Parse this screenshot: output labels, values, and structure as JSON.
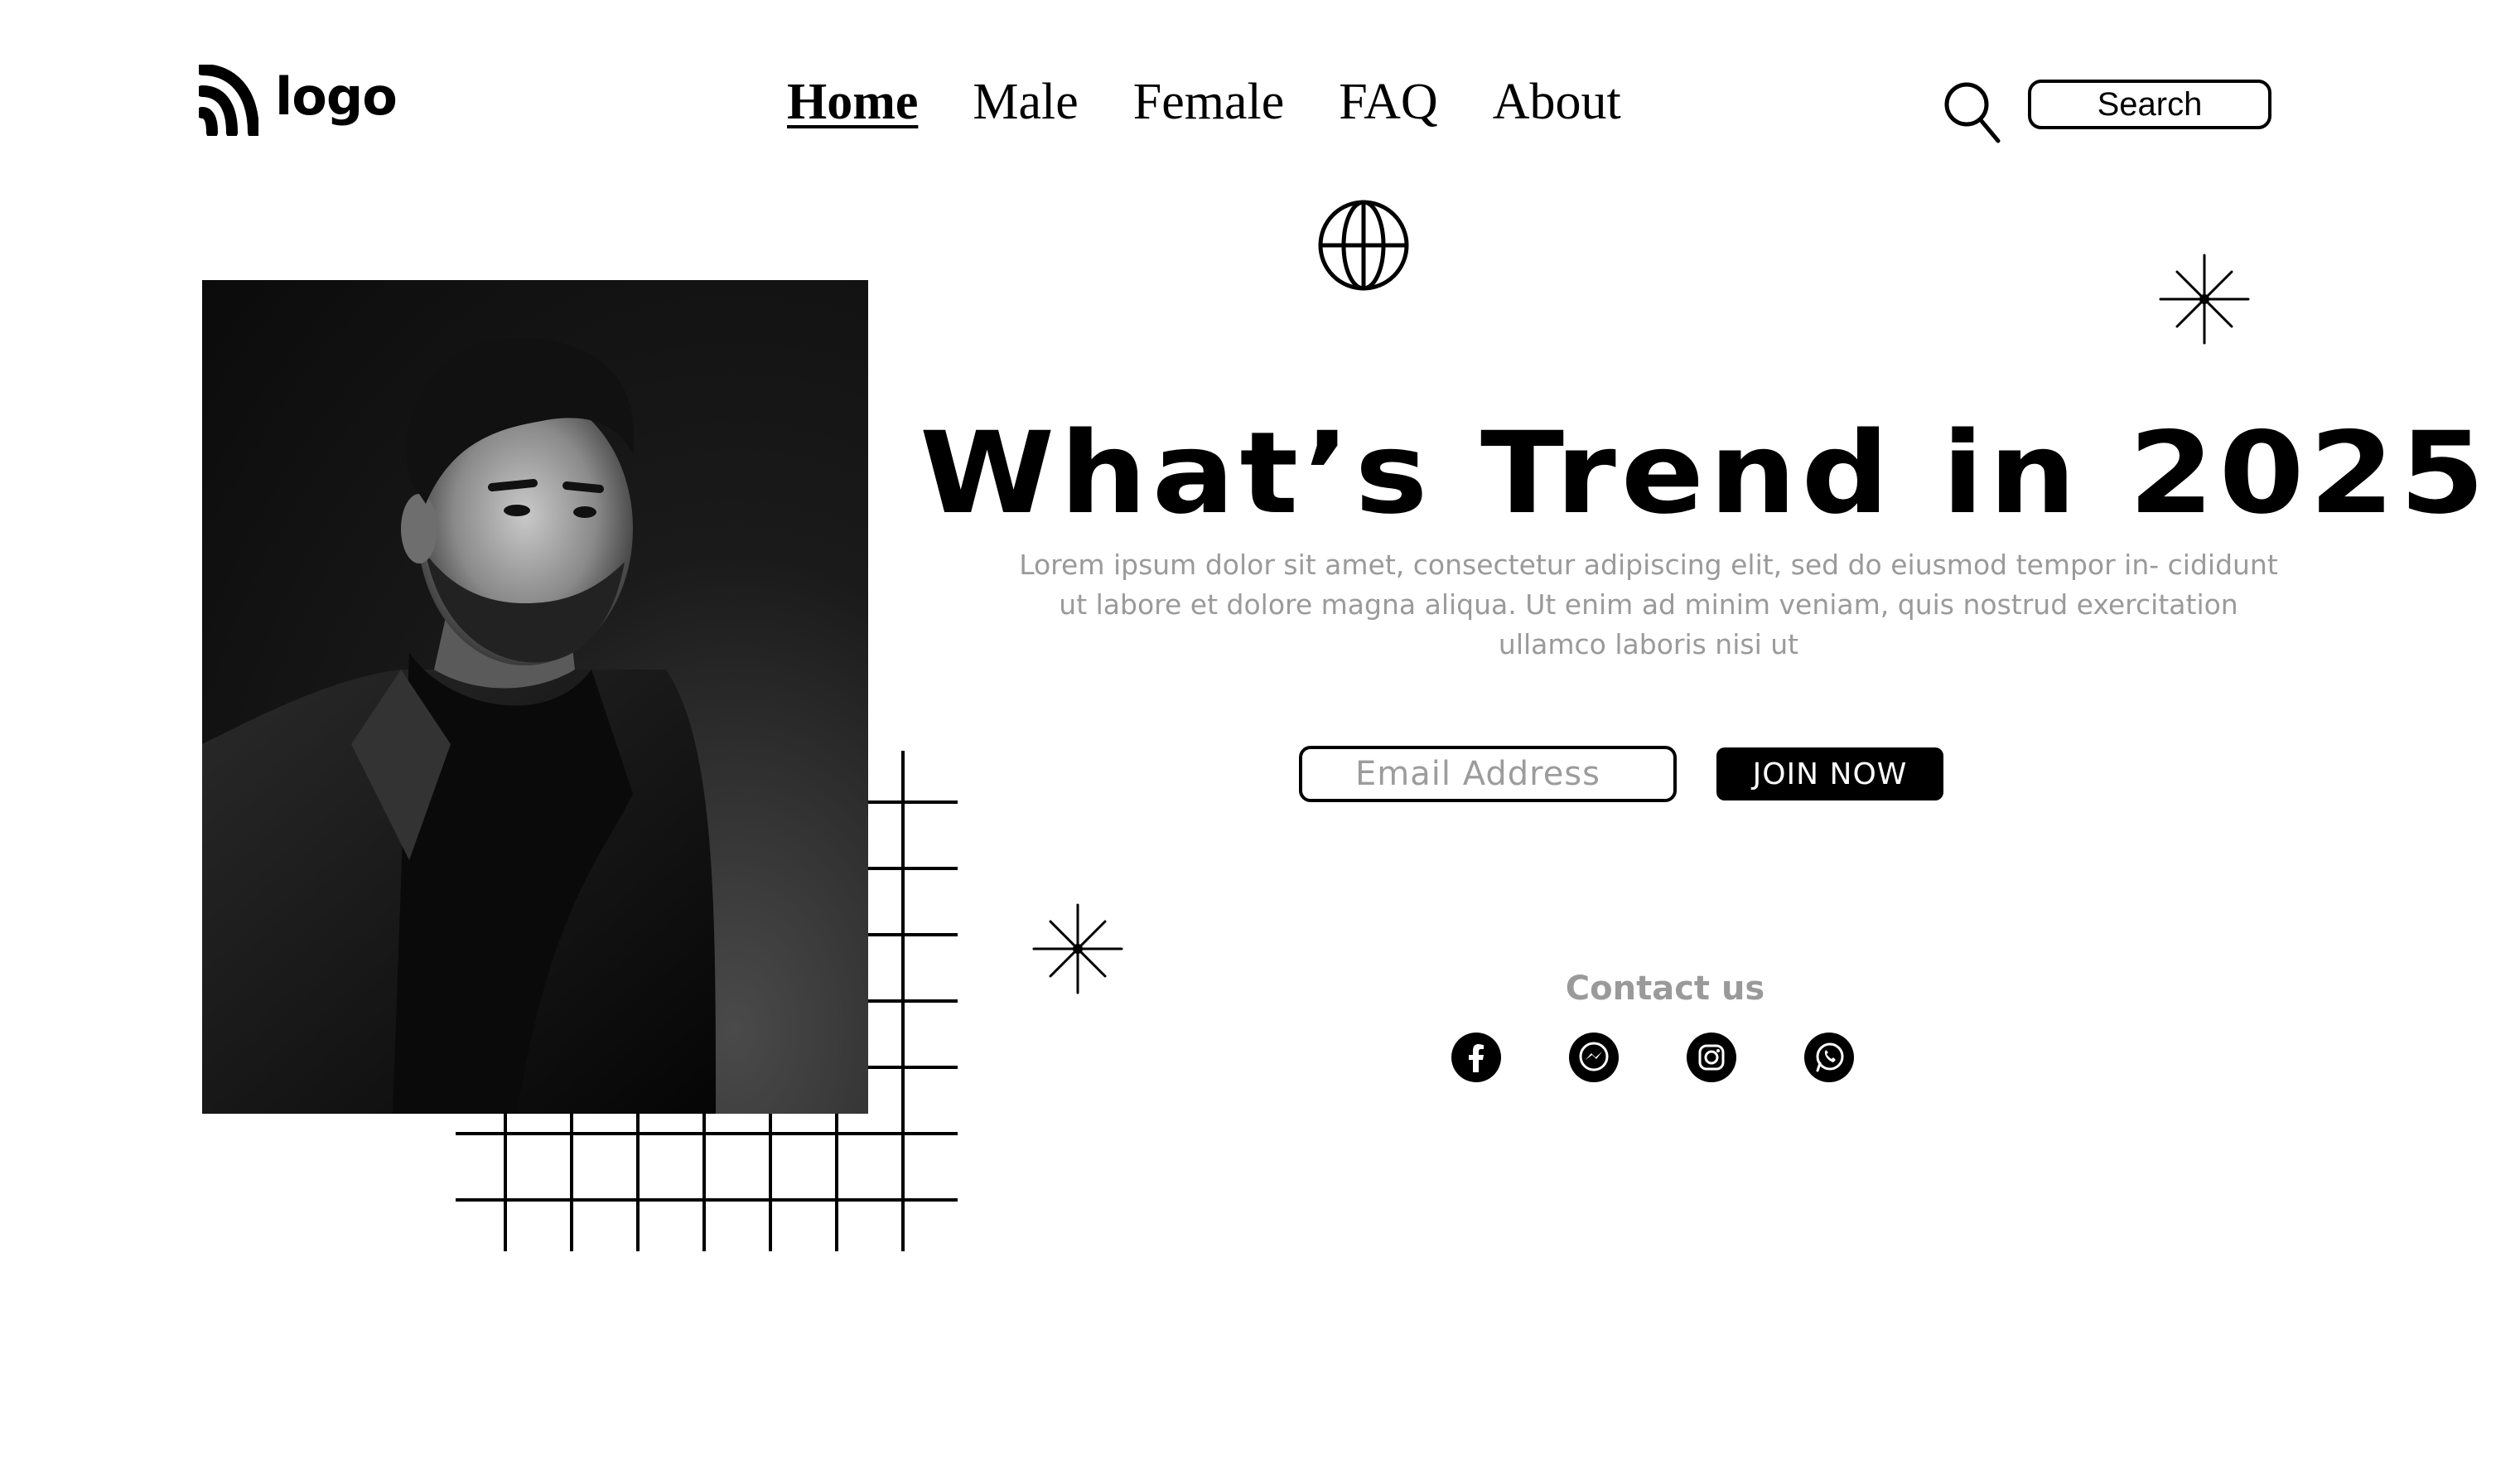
{
  "header": {
    "logo_text": "logo",
    "nav": [
      {
        "label": "Home",
        "active": true
      },
      {
        "label": "Male",
        "active": false
      },
      {
        "label": "Female",
        "active": false
      },
      {
        "label": "FAQ",
        "active": false
      },
      {
        "label": "About",
        "active": false
      }
    ],
    "search_label": "Search"
  },
  "hero": {
    "headline": "What’s Trend in 2025 ?",
    "description": "Lorem ipsum dolor sit amet, consectetur adipiscing elit, sed do eiusmod tempor in- cididunt ut labore et dolore magna aliqua. Ut enim ad minim veniam, quis nostrud exercitation ullamco laboris nisi ut",
    "email_placeholder": "Email Address",
    "join_label": "JOIN NOW"
  },
  "contact": {
    "title": "Contact us",
    "icons": [
      "facebook-icon",
      "messenger-icon",
      "instagram-icon",
      "whatsapp-icon"
    ]
  },
  "colors": {
    "primary": "#000000",
    "muted_text": "#9a9a9a",
    "background": "#ffffff"
  }
}
